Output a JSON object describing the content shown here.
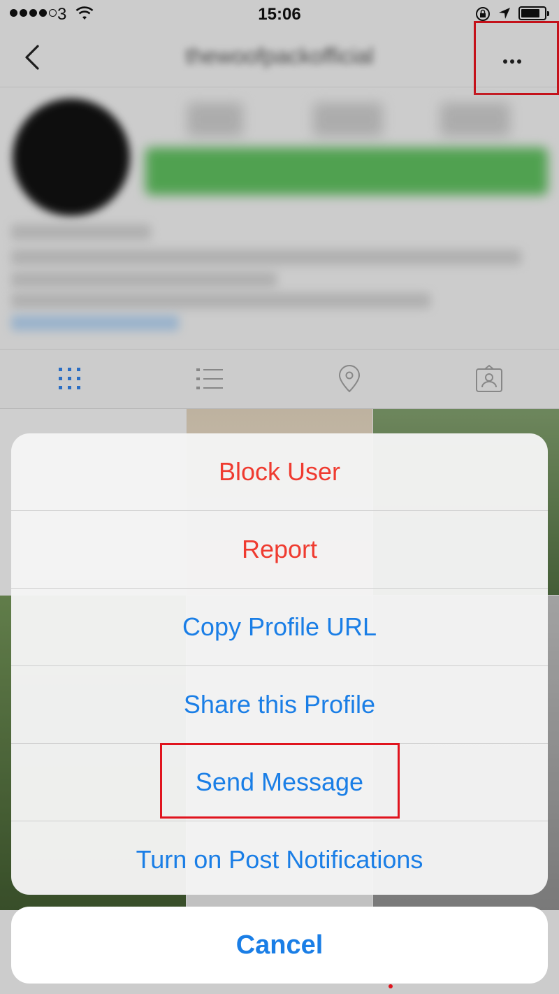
{
  "status_bar": {
    "carrier": "3",
    "time": "15:06"
  },
  "navbar": {
    "title": "thewoofpackofficial"
  },
  "action_sheet": {
    "items": [
      {
        "label": "Block User",
        "color": "#ef3b30"
      },
      {
        "label": "Report",
        "color": "#ef3b30"
      },
      {
        "label": "Copy Profile URL",
        "color": "#1a7ee6"
      },
      {
        "label": "Share this Profile",
        "color": "#1a7ee6"
      },
      {
        "label": "Send Message",
        "color": "#1a7ee6"
      },
      {
        "label": "Turn on Post Notifications",
        "color": "#1a7ee6"
      }
    ],
    "cancel_label": "Cancel",
    "cancel_color": "#1a7ee6"
  },
  "colors": {
    "highlight": "#e0141e",
    "tab_active": "#2f7de0",
    "tab_inactive": "#9a9a9a"
  },
  "icons": {
    "back": "chevron-left-icon",
    "more": "more-horizontal-icon",
    "tabs": [
      "grid-icon",
      "list-icon",
      "location-pin-icon",
      "tagged-user-icon"
    ]
  }
}
